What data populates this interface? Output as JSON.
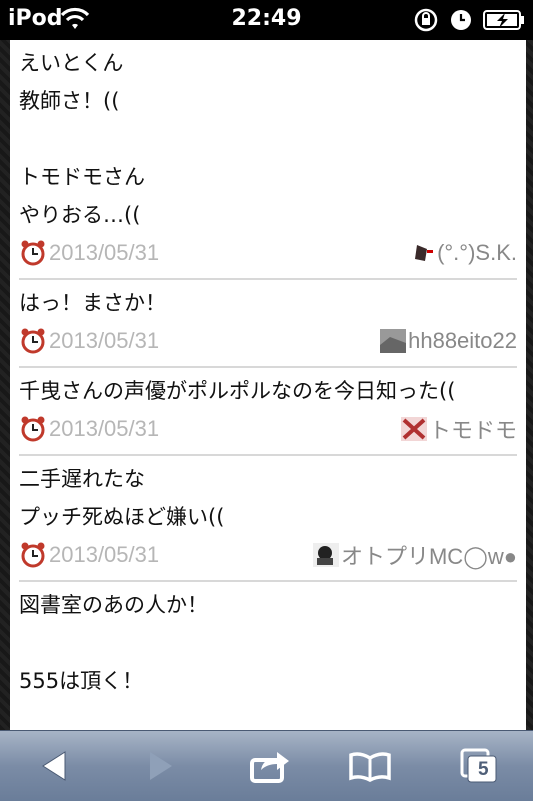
{
  "status": {
    "carrier": "iPod",
    "time": "22:49"
  },
  "posts": [
    {
      "lines": [
        "えいとくん",
        "教師さ！((",
        "",
        "トモドモさん",
        "やりおる…(("
      ],
      "date": "2013/05/31",
      "author": "(°.°)S.K."
    },
    {
      "lines": [
        "はっ！まさか！"
      ],
      "date": "2013/05/31",
      "author": "hh88eito22"
    },
    {
      "lines": [
        "千曳さんの声優がポルポルなのを今日知った(("
      ],
      "date": "2013/05/31",
      "author": "トモドモ"
    },
    {
      "lines": [
        "二手遅れたな",
        "プッチ死ぬほど嫌い(("
      ],
      "date": "2013/05/31",
      "author": "オトプリMC◯w●"
    },
    {
      "lines": [
        "図書室のあの人か！",
        "",
        "555は頂く！"
      ],
      "date": "",
      "author": ""
    }
  ],
  "toolbar": {
    "tabs_count": "5",
    "icons": [
      "back-icon",
      "forward-icon",
      "share-icon",
      "bookmarks-icon",
      "tabs-icon"
    ]
  },
  "colors": {
    "toolbar": "#7b8ca6",
    "date_text": "#b6b6b6",
    "author_text": "#888888"
  }
}
